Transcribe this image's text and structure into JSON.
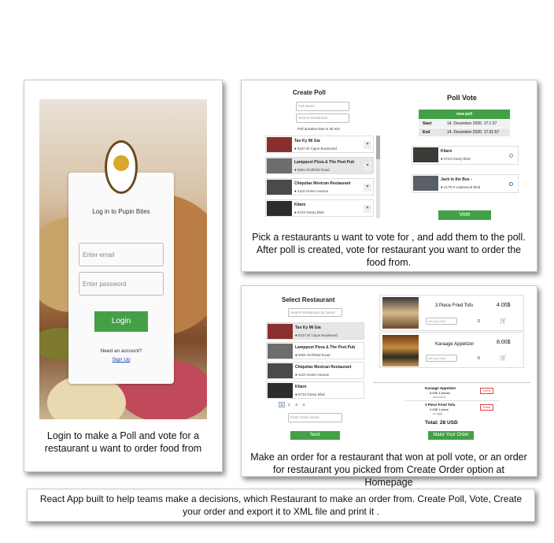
{
  "login": {
    "title": "Log in to Pupin Bites",
    "email_placeholder": "Enter email",
    "password_placeholder": "Enter password",
    "login_button": "Login",
    "need_account": "Need an account?",
    "signup_link": "Sign Up",
    "caption": "Login to make a Poll and vote for a restaurant u want to order food from"
  },
  "create_poll": {
    "title": "Create Poll",
    "poll_name_placeholder": "Poll Name",
    "search_placeholder": "Search Restaurant",
    "duration_text": "Poll duration time is 30 min",
    "restaurants": [
      {
        "name": "Tan Ky Mi Gia",
        "address": "5237 El Cajon Boulevard"
      },
      {
        "name": "Lamppost Pizza & The Post Pub",
        "address": "5091 Richfield Road"
      },
      {
        "name": "Chiquitas Mexican Restaurant",
        "address": "4110 Home Avenue"
      },
      {
        "name": "Kitaro",
        "address": "5723 Geary Blvd"
      }
    ]
  },
  "poll_vote": {
    "title": "Poll Vote",
    "poll_name": "new poll",
    "start_label": "Start",
    "start_value": "14. December 2020. 17:1 57",
    "end_label": "End",
    "end_value": "14. December 2020. 17:31:57",
    "candidates": [
      {
        "name": "Kitaro",
        "address": "5723 Geary Blvd"
      },
      {
        "name": "Jack in the Box -",
        "address": "4175 N Lakewood Blvd"
      }
    ],
    "vote_button": "Vote",
    "caption": "Pick a restaurants u want to vote for , and add them to the poll. After poll is created, vote for restaurant you want to order the food from."
  },
  "select_restaurant": {
    "title": "Select Restaurant",
    "search_placeholder": "Search Restaurant by Name",
    "restaurants": [
      {
        "name": "Tan Ky Mi Gia",
        "address": "5237 El Cajon Boulevard"
      },
      {
        "name": "Lamppost Pizza & The Post Pub",
        "address": "5091 Richfield Road"
      },
      {
        "name": "Chiquitas Mexican Restaurant",
        "address": "4110 Home Avenue"
      },
      {
        "name": "Kitaro",
        "address": "5723 Geary Blvd"
      }
    ],
    "pages": [
      "1",
      "2",
      "3",
      "4"
    ],
    "order_name_placeholder": "Enter Order Name",
    "next_button": "Next"
  },
  "menu": {
    "items": [
      {
        "name": "3 Piece Fried Tofu",
        "price": "4.00$",
        "note_placeholder": "Add your Note",
        "qty": "0"
      },
      {
        "name": "Karaage Appetizer",
        "price": "8.00$",
        "note_placeholder": "Add your Note",
        "qty": "0"
      }
    ],
    "order_lines": [
      {
        "name": "Karaage Appetizer",
        "detail": "8.00$ 3 pieces",
        "note": "sos sotium",
        "delete": "Delete"
      },
      {
        "name": "3 Piece Fried Tofu",
        "detail": "4.00$ 1 piece",
        "note": "no eggs",
        "delete": "Delete"
      }
    ],
    "total": "Total: 28 USD",
    "make_order_button": "Make Your Order",
    "caption": "Make an order for a restaurant that won at poll vote, or an order for restaurant you picked from Create Order option at Homepage"
  },
  "footer": {
    "text": "React App  built to help teams make a decisions, which Restaurant to make an order from.  Create Poll, Vote, Create your order and export it to XML file and print it ."
  },
  "colors": {
    "green": "#43a047",
    "brown": "#6b4a1e",
    "blue_link": "#1a4fb3"
  }
}
